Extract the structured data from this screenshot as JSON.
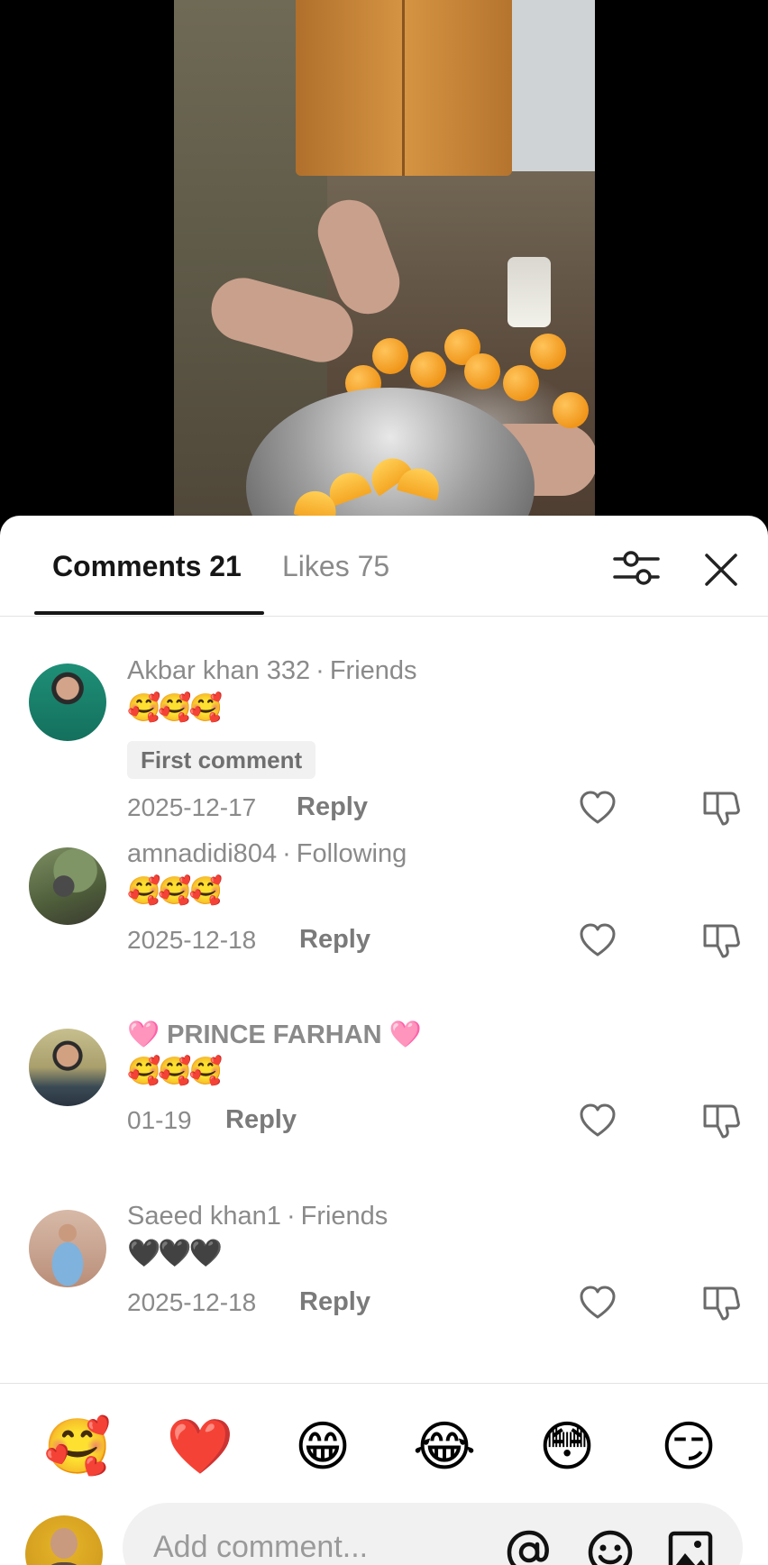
{
  "tabs": {
    "comments_label": "Comments 21",
    "likes_label": "Likes 75"
  },
  "comments": [
    {
      "username": "Akbar khan 332",
      "relation": "Friends",
      "text": "🥰🥰🥰",
      "badge": "First comment",
      "date": "2025-12-17",
      "reply_label": "Reply"
    },
    {
      "username": "amnadidi804",
      "relation": "Following",
      "text": "🥰🥰🥰",
      "date": "2025-12-18",
      "reply_label": "Reply"
    },
    {
      "username": "🩷 PRINCE FARHAN 🩷",
      "text": "🥰🥰🥰",
      "date": "01-19",
      "reply_label": "Reply"
    },
    {
      "username": "Saeed khan1",
      "relation": "Friends",
      "text": "🖤🖤🖤",
      "date": "2025-12-18",
      "reply_label": "Reply"
    }
  ],
  "quick_emojis": [
    "🥰",
    "❤️",
    "😁",
    "😂",
    "😳",
    "😏"
  ],
  "composer": {
    "placeholder": "Add comment..."
  },
  "icons": {
    "filter": "sliders-icon",
    "close": "close-icon",
    "like": "heart-outline-icon",
    "dislike": "thumbs-down-icon",
    "mention": "at-icon",
    "emoji": "smiley-icon",
    "image": "image-icon"
  },
  "colors": {
    "sheet_background": "#ffffff",
    "primary_text": "#161616",
    "secondary_text": "#8a8a8a",
    "badge_background": "#f1f1f1"
  }
}
